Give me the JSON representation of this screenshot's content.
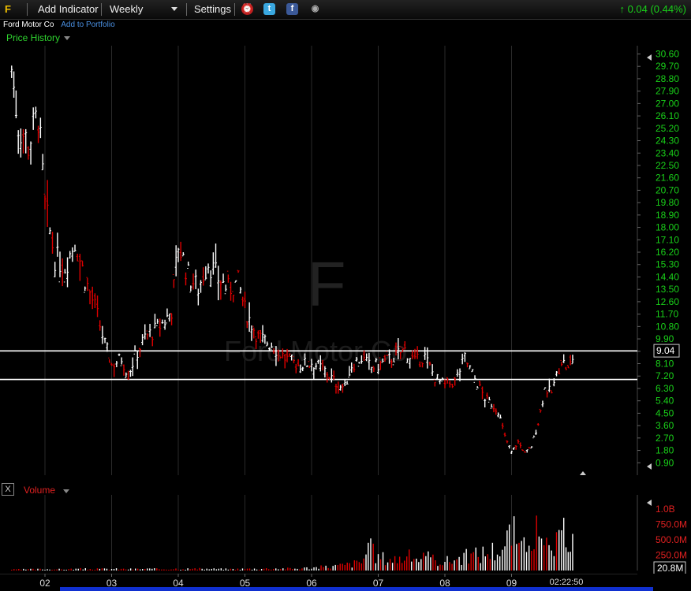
{
  "toolbar": {
    "symbol": "F",
    "add_indicator": "Add Indicator",
    "period": "Weekly",
    "settings": "Settings",
    "icons": [
      "alarm-clock-icon",
      "twitter-icon",
      "facebook-icon",
      "camera-icon"
    ],
    "change": "0.04 (0.44%)"
  },
  "subbar": {
    "company": "Ford Motor Co",
    "portfolio_link": "Add to Portfolio"
  },
  "price_panel": {
    "label": "Price History",
    "watermark_symbol": "F",
    "watermark_name": "Ford Motor Co"
  },
  "volume_panel": {
    "label": "Volume",
    "close_label": "X"
  },
  "time_label": "02:22:50",
  "colors": {
    "up": "#ffffff",
    "down": "#e00000",
    "axis_text": "#19d019",
    "volume_axis_text": "#e02020",
    "grid": "#2a2a2a"
  },
  "chart_data": [
    {
      "type": "candlestick",
      "title": "Price History",
      "x_tick_labels": [
        "02",
        "03",
        "04",
        "05",
        "06",
        "07",
        "08",
        "09"
      ],
      "y_tick_labels": [
        "30.60",
        "29.70",
        "28.80",
        "27.90",
        "27.00",
        "26.10",
        "25.20",
        "24.30",
        "23.40",
        "22.50",
        "21.60",
        "20.70",
        "19.80",
        "18.90",
        "18.00",
        "17.10",
        "16.20",
        "15.30",
        "14.40",
        "13.50",
        "12.60",
        "11.70",
        "10.80",
        "9.90",
        "9.00",
        "8.10",
        "7.20",
        "6.30",
        "5.40",
        "4.50",
        "3.60",
        "2.70",
        "1.80",
        "0.90"
      ],
      "ylim": [
        0.0,
        31.2
      ],
      "current_price": "9.04",
      "horizontal_lines": [
        9.03,
        6.95
      ],
      "series": [
        {
          "x": [
            2001.5,
            2001.6,
            2001.75,
            2001.9,
            2002.0,
            2002.15,
            2002.3,
            2002.45,
            2002.6,
            2002.75,
            2002.9,
            2003.0,
            2003.15,
            2003.25,
            2003.35,
            2003.5,
            2003.65,
            2003.8,
            2003.9,
            2004.0,
            2004.15,
            2004.3,
            2004.45,
            2004.6,
            2004.75,
            2004.9,
            2005.0,
            2005.2,
            2005.4,
            2005.6,
            2005.8,
            2006.0,
            2006.2,
            2006.4,
            2006.5,
            2006.6,
            2006.75,
            2006.9,
            2007.0,
            2007.2,
            2007.4,
            2007.55,
            2007.7,
            2007.85,
            2008.0,
            2008.15,
            2008.3,
            2008.45,
            2008.6,
            2008.8,
            2008.9,
            2009.0,
            2009.1,
            2009.2,
            2009.3,
            2009.4,
            2009.5,
            2009.6,
            2009.75,
            2009.85,
            2009.95
          ],
          "values": [
            29.5,
            25.5,
            24.0,
            26.2,
            19.5,
            15.8,
            15.2,
            17.0,
            14.3,
            12.2,
            9.5,
            8.0,
            8.5,
            7.3,
            8.6,
            10.0,
            10.5,
            11.2,
            12.0,
            16.8,
            14.5,
            13.6,
            15.5,
            14.3,
            13.5,
            14.0,
            12.0,
            10.0,
            9.5,
            8.5,
            8.0,
            8.2,
            7.6,
            6.5,
            6.4,
            8.0,
            8.5,
            7.8,
            8.0,
            8.5,
            9.1,
            8.2,
            8.6,
            7.1,
            6.5,
            6.8,
            8.5,
            7.0,
            5.6,
            4.7,
            2.8,
            1.7,
            2.4,
            1.6,
            2.1,
            3.8,
            6.3,
            6.0,
            8.4,
            7.6,
            9.0
          ]
        }
      ]
    },
    {
      "type": "bar",
      "title": "Volume",
      "y_tick_labels": [
        "1.0B",
        "750.0M",
        "500.0M",
        "250.0M"
      ],
      "current_value": "20.8M",
      "ylim": [
        0,
        1100000000
      ],
      "x": [
        2001.5,
        2001.75,
        2002.0,
        2002.25,
        2002.5,
        2002.75,
        2003.0,
        2003.25,
        2003.5,
        2003.75,
        2004.0,
        2004.25,
        2004.5,
        2004.75,
        2005.0,
        2005.25,
        2005.5,
        2005.75,
        2006.0,
        2006.25,
        2006.5,
        2006.75,
        2006.85,
        2007.0,
        2007.25,
        2007.5,
        2007.75,
        2008.0,
        2008.25,
        2008.5,
        2008.75,
        2008.9,
        2009.0,
        2009.15,
        2009.3,
        2009.45,
        2009.6,
        2009.75,
        2009.85,
        2009.95
      ],
      "values": [
        20000000,
        25000000,
        30000000,
        25000000,
        35000000,
        30000000,
        35000000,
        30000000,
        35000000,
        30000000,
        40000000,
        35000000,
        35000000,
        30000000,
        35000000,
        40000000,
        45000000,
        40000000,
        60000000,
        80000000,
        120000000,
        180000000,
        500000000,
        280000000,
        250000000,
        300000000,
        260000000,
        200000000,
        280000000,
        350000000,
        450000000,
        520000000,
        900000000,
        420000000,
        1050000000,
        500000000,
        450000000,
        650000000,
        900000000,
        520000000
      ]
    }
  ]
}
